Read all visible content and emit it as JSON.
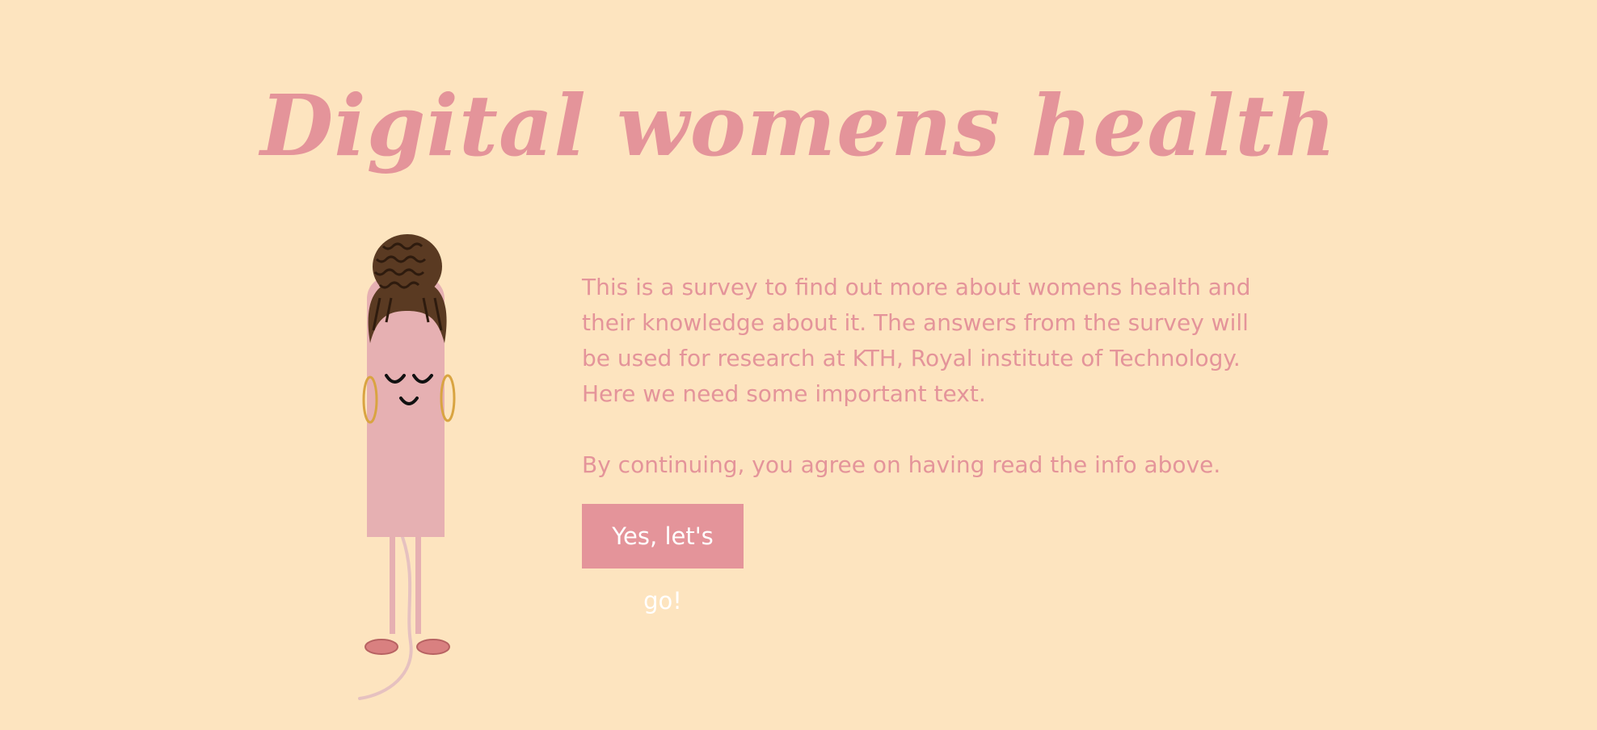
{
  "header": {
    "title": "Digital womens health"
  },
  "main": {
    "intro": "This is a survey to find out more about womens health and their knowledge about it. The answers from the survey will be used for research at KTH, Royal institute of Technology. Here we need some important text.",
    "consent": "By continuing, you agree on having read the info above.",
    "start_button_label": "Yes, let's go!"
  },
  "colors": {
    "background": "#fde4bf",
    "accent": "#e4949a",
    "button_text": "#ffffff",
    "figure_body": "#e6b0b2",
    "hair": "#5a3a22",
    "earring": "#d9a441"
  },
  "illustration": {
    "icon": "tampon-character-illustration"
  }
}
